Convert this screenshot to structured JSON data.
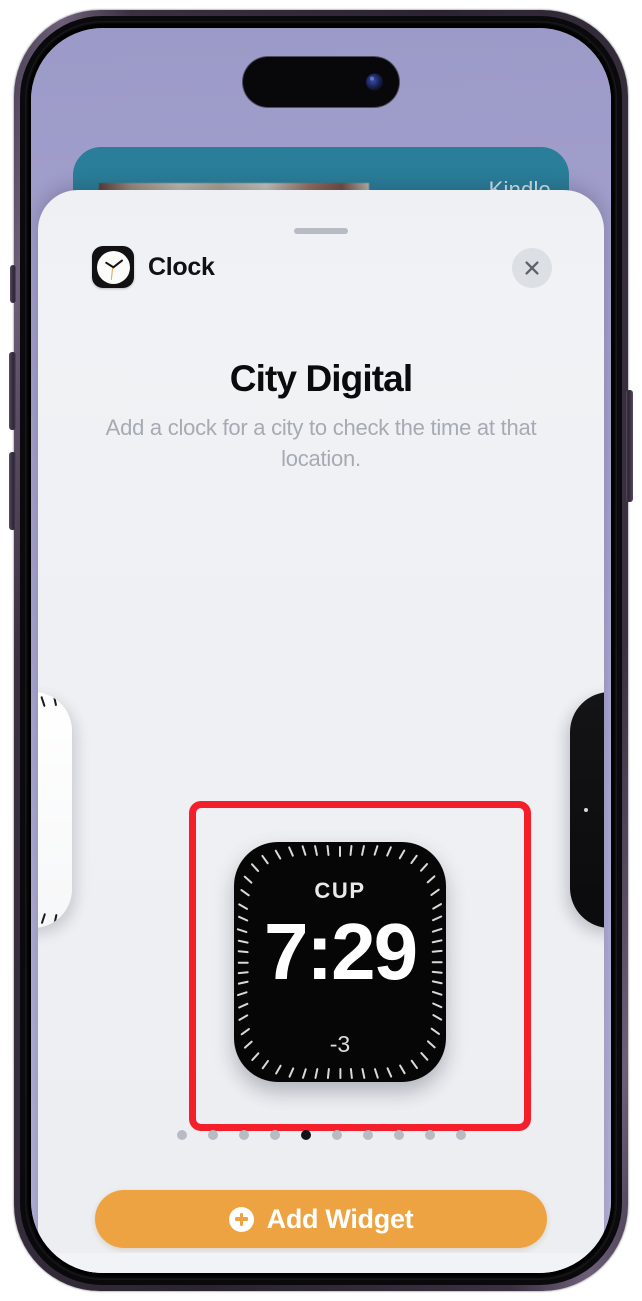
{
  "sheet": {
    "app_name": "Clock",
    "app_icon": "clock-app-icon",
    "close_icon": "close-icon",
    "grabber": "sheet-grabber",
    "widget_title": "City Digital",
    "widget_description": "Add a clock for a city to check the time at that location."
  },
  "background_card": {
    "label": "Kindle"
  },
  "widget_preview": {
    "city_code": "CUP",
    "time": "7:29",
    "offset": "-3"
  },
  "carousel": {
    "total_pages": 10,
    "active_page": 5,
    "dots": [
      {
        "active": false
      },
      {
        "active": false
      },
      {
        "active": false
      },
      {
        "active": false
      },
      {
        "active": true
      },
      {
        "active": false
      },
      {
        "active": false
      },
      {
        "active": false
      },
      {
        "active": false
      },
      {
        "active": false
      }
    ]
  },
  "footer": {
    "add_widget_label": "Add Widget",
    "add_icon": "plus-circle-icon"
  },
  "colors": {
    "accent_orange": "#eda342",
    "highlight_red": "#f51f2c",
    "sheet_background": "#eef0f4",
    "widget_background": "#060607",
    "wallpaper": "#a7a4cd",
    "bg_card_teal": "#2a7e99",
    "title_text": "#0a0b0d",
    "description_text": "#a6abb3"
  }
}
